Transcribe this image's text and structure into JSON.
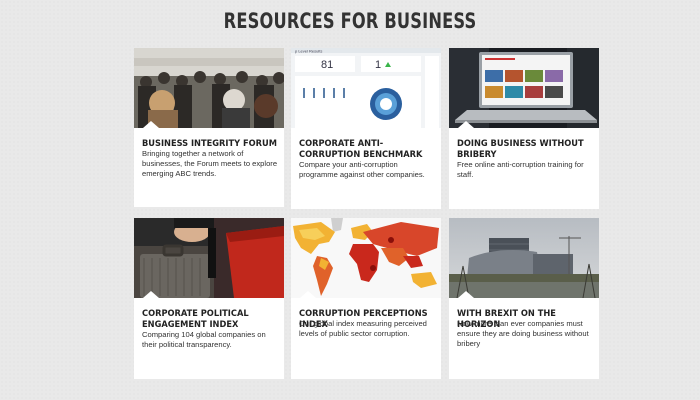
{
  "page": {
    "title": "RESOURCES FOR BUSINESS"
  },
  "cards": [
    {
      "title": "Business Integrity Forum",
      "description": "Bringing together a network of businesses, the Forum meets to explore emerging ABC trends.",
      "image": "conference-audience-photo"
    },
    {
      "title": "Corporate Anti-Corruption Benchmark",
      "description": "Compare your anti-corruption programme against other companies.",
      "image": "benchmark-dashboard-screenshot",
      "image_text": {
        "heading": "p Level Results",
        "stat_a": "81",
        "stat_b": "1"
      }
    },
    {
      "title": "Doing Business Without Bribery",
      "description": "Free online anti-corruption training for staff.",
      "image": "laptop-photo"
    },
    {
      "title": "Corporate Political Engagement Index",
      "description": "Comparing 104 global companies on their political transparency.",
      "image": "briefcase-handover-photo"
    },
    {
      "title": "Corruption Perceptions Index",
      "description": "Our global index measuring perceived levels of public sector corruption.",
      "image": "world-map-heatmap"
    },
    {
      "title": "With Brexit on the Horizon",
      "description": "Now more than ever companies must ensure they are doing business without bribery",
      "image": "eu-parliament-building-photo"
    }
  ]
}
